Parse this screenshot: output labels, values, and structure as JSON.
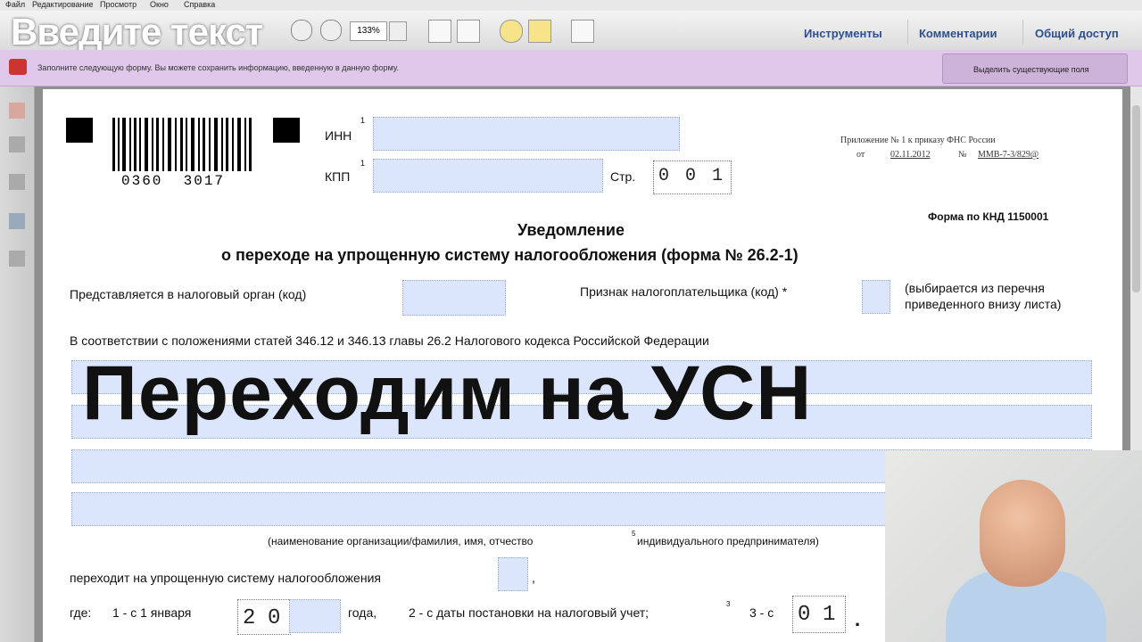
{
  "menu": [
    "Файл",
    "Редактирование",
    "Просмотр",
    "Окно",
    "Справка"
  ],
  "overlay_top": "Введите текст",
  "toolbar": {
    "zoom": "133%",
    "tools": "Инструменты",
    "comments": "Комментарии",
    "share": "Общий доступ"
  },
  "formbar": {
    "message": "Заполните следующую форму. Вы можете сохранить информацию, введенную в данную форму.",
    "highlight": "Выделить существующие поля"
  },
  "doc": {
    "barcode_number": "0360  3017",
    "inn_label": "ИНН",
    "kpp_label": "КПП",
    "sup1": "1",
    "page_label": "Стр.",
    "page_digits": [
      "0",
      "0",
      "1"
    ],
    "appendix": "Приложение № 1 к приказу ФНС России",
    "appendix_from": "от",
    "appendix_date": "02.11.2012",
    "appendix_no": "№",
    "appendix_num": "ММВ-7-3/829@",
    "form_knd": "Форма по КНД 1150001",
    "title1": "Уведомление",
    "title2": "о  переходе на упрощенную систему налогообложения (форма № 26.2-1)",
    "tax_organ": "Представляется в налоговый орган (код)",
    "taxpayer_sign": "Признак налогоплательщика (код) *",
    "taxpayer_note1": "(выбирается из перечня",
    "taxpayer_note2": "приведенного внизу листа)",
    "accordance": "В соответствии с положениями статей 346.12 и 346.13 главы 26.2 Налогового кодекса Российской Федерации",
    "org_name_caption": "(наименование организации/фамилия, имя, отчество",
    "sup5": "5",
    "org_name_caption2": "индивидуального предпринимателя)",
    "transition": "переходит на упрощенную систему налогообложения",
    "comma": ",",
    "where": "где:",
    "opt1": "1 - с 1 января",
    "year_digits": [
      "2",
      "0"
    ],
    "year_suffix": "года,",
    "opt2": "2 - с даты постановки на налоговый учет;",
    "sup3": "3",
    "opt3": "3 - с",
    "month_digits": [
      "0",
      "1"
    ],
    "dot": "."
  },
  "big_title": "Переходим на УСН"
}
